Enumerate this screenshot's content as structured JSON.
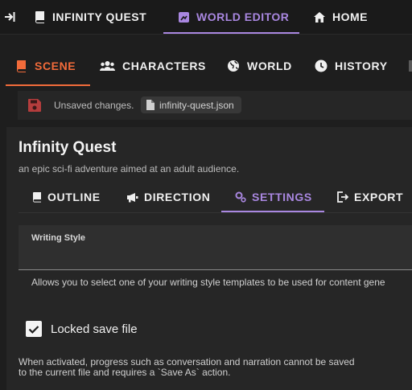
{
  "topnav": {
    "items": [
      {
        "label": "INFINITY QUEST",
        "icon": "book-icon"
      },
      {
        "label": "WORLD EDITOR",
        "icon": "map-icon",
        "active": true
      },
      {
        "label": "HOME",
        "icon": "home-icon"
      }
    ],
    "accent": "#a987e0"
  },
  "tabs": {
    "items": [
      {
        "label": "SCENE",
        "icon": "book-icon",
        "active": true
      },
      {
        "label": "CHARACTERS",
        "icon": "people-icon"
      },
      {
        "label": "WORLD",
        "icon": "globe-icon"
      },
      {
        "label": "HISTORY",
        "icon": "clock-icon"
      }
    ],
    "accent": "#f26b3a"
  },
  "save": {
    "message": "Unsaved changes.",
    "filename": "infinity-quest.json"
  },
  "scene": {
    "title": "Infinity Quest",
    "subtitle": "an epic sci-fi adventure aimed at an adult audience.",
    "tabs": [
      {
        "label": "OUTLINE",
        "icon": "book-icon"
      },
      {
        "label": "DIRECTION",
        "icon": "megaphone-icon"
      },
      {
        "label": "SETTINGS",
        "icon": "gears-icon",
        "active": true
      },
      {
        "label": "EXPORT",
        "icon": "export-icon"
      }
    ]
  },
  "settings": {
    "writing_style_label": "Writing Style",
    "writing_style_value": "",
    "writing_style_helper": "Allows you to select one of your writing style templates to be used for content gene",
    "locked_label": "Locked save file",
    "locked_checked": true,
    "locked_note": "When activated, progress such as conversation and narration cannot be saved to the current file and requires a `Save As` action."
  }
}
